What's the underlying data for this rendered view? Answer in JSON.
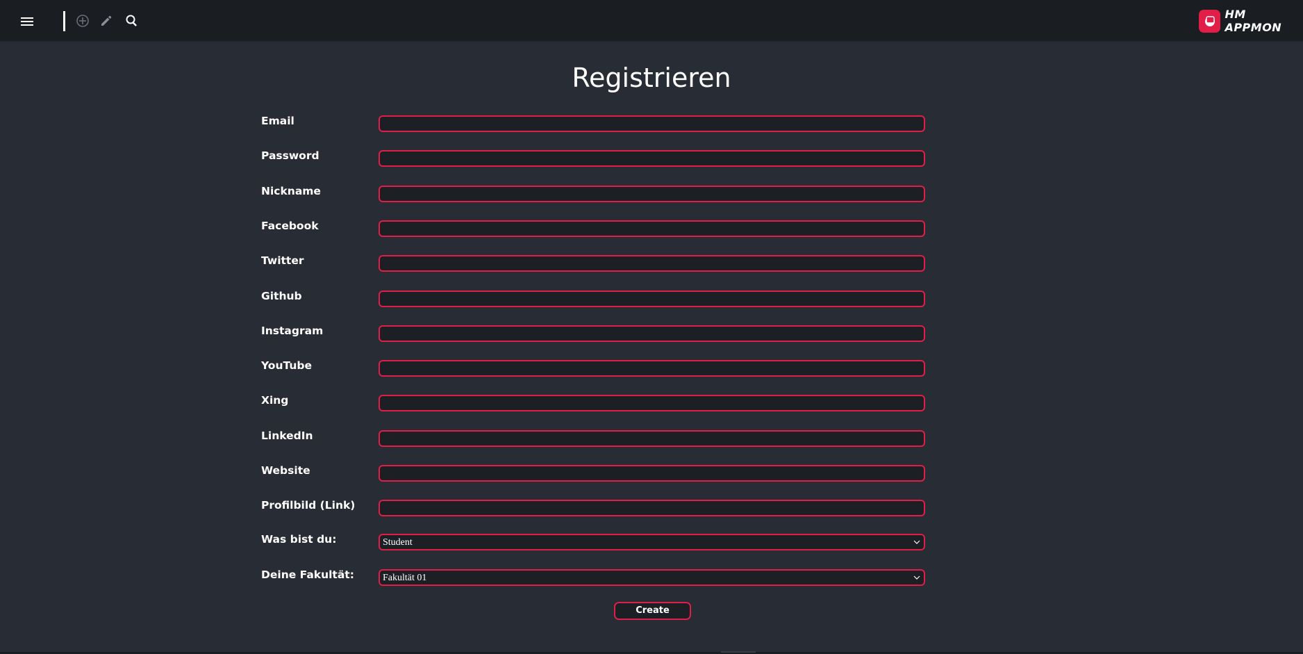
{
  "header": {
    "menu_icon": "hamburger-menu-icon",
    "add_icon": "add-circle-icon",
    "edit_icon": "pencil-icon",
    "search_icon": "search-icon",
    "brand_name": "HM APPMON",
    "brand_color": "#e11d48"
  },
  "page": {
    "title": "Registrieren"
  },
  "form": {
    "fields": [
      {
        "label": "Email",
        "value": ""
      },
      {
        "label": "Password",
        "value": ""
      },
      {
        "label": "Nickname",
        "value": ""
      },
      {
        "label": "Facebook",
        "value": ""
      },
      {
        "label": "Twitter",
        "value": ""
      },
      {
        "label": "Github",
        "value": ""
      },
      {
        "label": "Instagram",
        "value": ""
      },
      {
        "label": "YouTube",
        "value": ""
      },
      {
        "label": "Xing",
        "value": ""
      },
      {
        "label": "LinkedIn",
        "value": ""
      },
      {
        "label": "Website",
        "value": ""
      },
      {
        "label": "Profilbild (Link)",
        "value": ""
      }
    ],
    "role": {
      "label": "Was bist du:",
      "selected": "Student"
    },
    "faculty": {
      "label": "Deine Fakultät:",
      "selected": "Fakultät 01"
    },
    "submit_label": "Create"
  },
  "colors": {
    "background": "#282c34",
    "topbar": "#1a1d22",
    "input_background": "#1c1f24",
    "accent": "#e11d48"
  }
}
